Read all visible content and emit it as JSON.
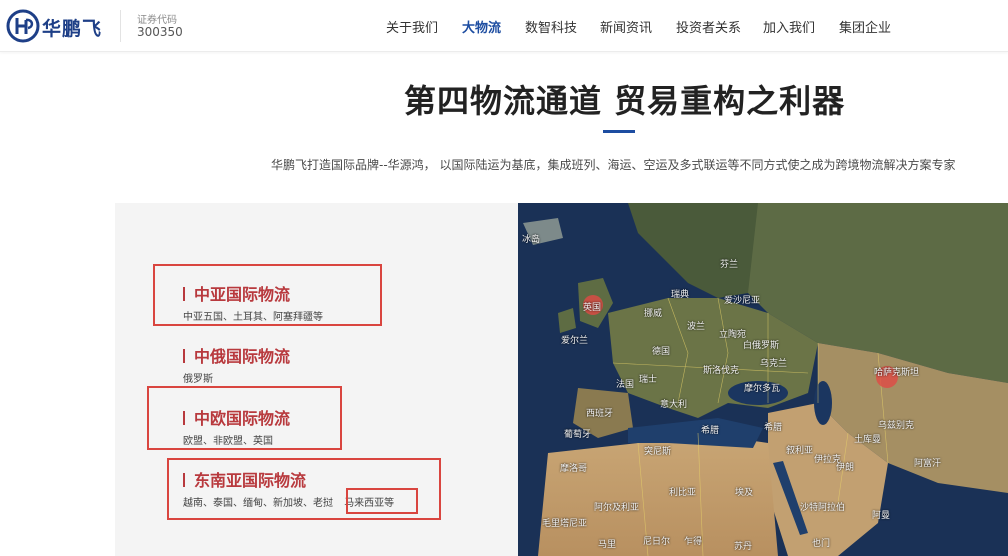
{
  "header": {
    "logo_text": "华鹏飞",
    "stock_label": "证券代码",
    "stock_code": "300350",
    "nav": [
      "关于我们",
      "大物流",
      "数智科技",
      "新闻资讯",
      "投资者关系",
      "加入我们",
      "集团企业"
    ],
    "active_nav": "大物流"
  },
  "hero": {
    "title": "第四物流通道 贸易重构之利器",
    "subtitle": "华鹏飞打造国际品牌--华源鸿， 以国际陆运为基底，集成班列、海运、空运及多式联运等不同方式使之成为跨境物流解决方案专家"
  },
  "routes": [
    {
      "title": "中亚国际物流",
      "desc": "中亚五国、土耳其、阿塞拜疆等"
    },
    {
      "title": "中俄国际物流",
      "desc": "俄罗斯"
    },
    {
      "title": "中欧国际物流",
      "desc": "欧盟、非欧盟、英国"
    },
    {
      "title": "东南亚国际物流",
      "desc": "越南、泰国、缅甸、新加坡、老挝",
      "desc_highlight": "马来西亚等"
    }
  ],
  "map": {
    "labels": [
      "冰岛",
      "英国",
      "挪威",
      "瑞典",
      "芬兰",
      "爱沙尼亚",
      "立陶宛",
      "白俄罗斯",
      "爱尔兰",
      "德国",
      "波兰",
      "法国",
      "瑞士",
      "斯洛伐克",
      "乌克兰",
      "摩尔多瓦",
      "意大利",
      "西班牙",
      "葡萄牙",
      "希腊",
      "希腊",
      "突尼斯",
      "摩洛哥",
      "阿尔及利亚",
      "利比亚",
      "埃及",
      "叙利亚",
      "伊拉克",
      "伊朗",
      "沙特阿拉伯",
      "毛里塔尼亚",
      "马里",
      "尼日尔",
      "乍得",
      "苏丹",
      "也门",
      "哈萨克斯坦",
      "阿富汗",
      "土库曼",
      "乌兹别克",
      "阿曼"
    ],
    "highlight_color": "#e04a45"
  },
  "colors": {
    "brand_blue": "#1e3f87",
    "nav_active": "#1d4da1",
    "route_red": "#b8393d",
    "box_red": "#d9453f"
  }
}
